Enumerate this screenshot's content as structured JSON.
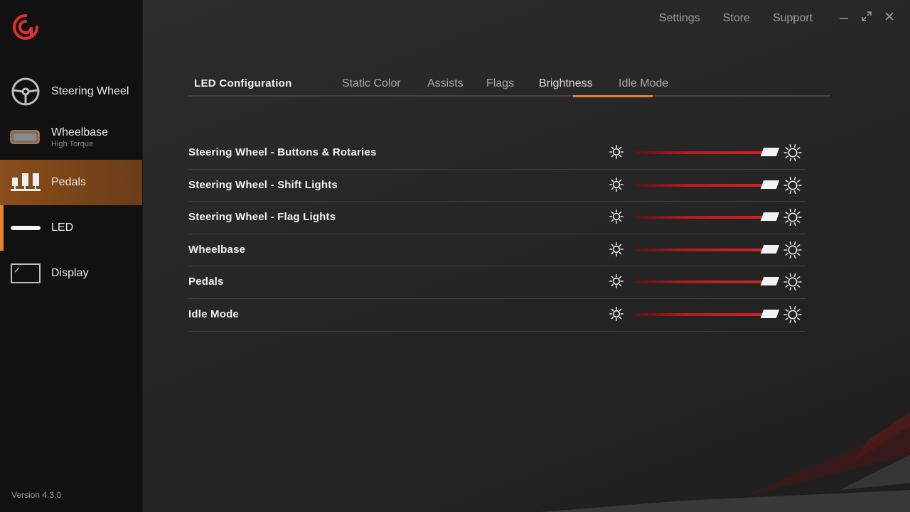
{
  "sidebar": {
    "items": [
      {
        "label": "Steering Wheel",
        "sub": "",
        "icon": "steering-wheel-icon"
      },
      {
        "label": "Wheelbase",
        "sub": "High Torque",
        "icon": "wheelbase-icon"
      },
      {
        "label": "Pedals",
        "sub": "",
        "icon": "pedals-icon",
        "active": true
      },
      {
        "label": "LED",
        "sub": "",
        "icon": "led-bar-icon"
      },
      {
        "label": "Display",
        "sub": "",
        "icon": "display-icon"
      }
    ],
    "version": "Version 4.3.0"
  },
  "header": {
    "links": [
      "Settings",
      "Store",
      "Support"
    ]
  },
  "tabs": {
    "title": "LED Configuration",
    "items": [
      "Static Color",
      "Assists",
      "Flags",
      "Brightness",
      "Idle Mode"
    ],
    "active": "Brightness"
  },
  "brightness_rows": [
    {
      "label": "Steering Wheel - Buttons & Rotaries",
      "level": 0.99
    },
    {
      "label": "Steering Wheel - Shift Lights",
      "level": 0.99
    },
    {
      "label": "Steering Wheel - Flag Lights",
      "level": 0.99
    },
    {
      "label": "Wheelbase",
      "level": 0.99
    },
    {
      "label": "Pedals",
      "level": 0.99
    },
    {
      "label": "Idle Mode",
      "level": 0.99
    }
  ],
  "colors": {
    "accent": "#e8822c",
    "brand_red": "#e03030",
    "slider": "#d22424"
  }
}
